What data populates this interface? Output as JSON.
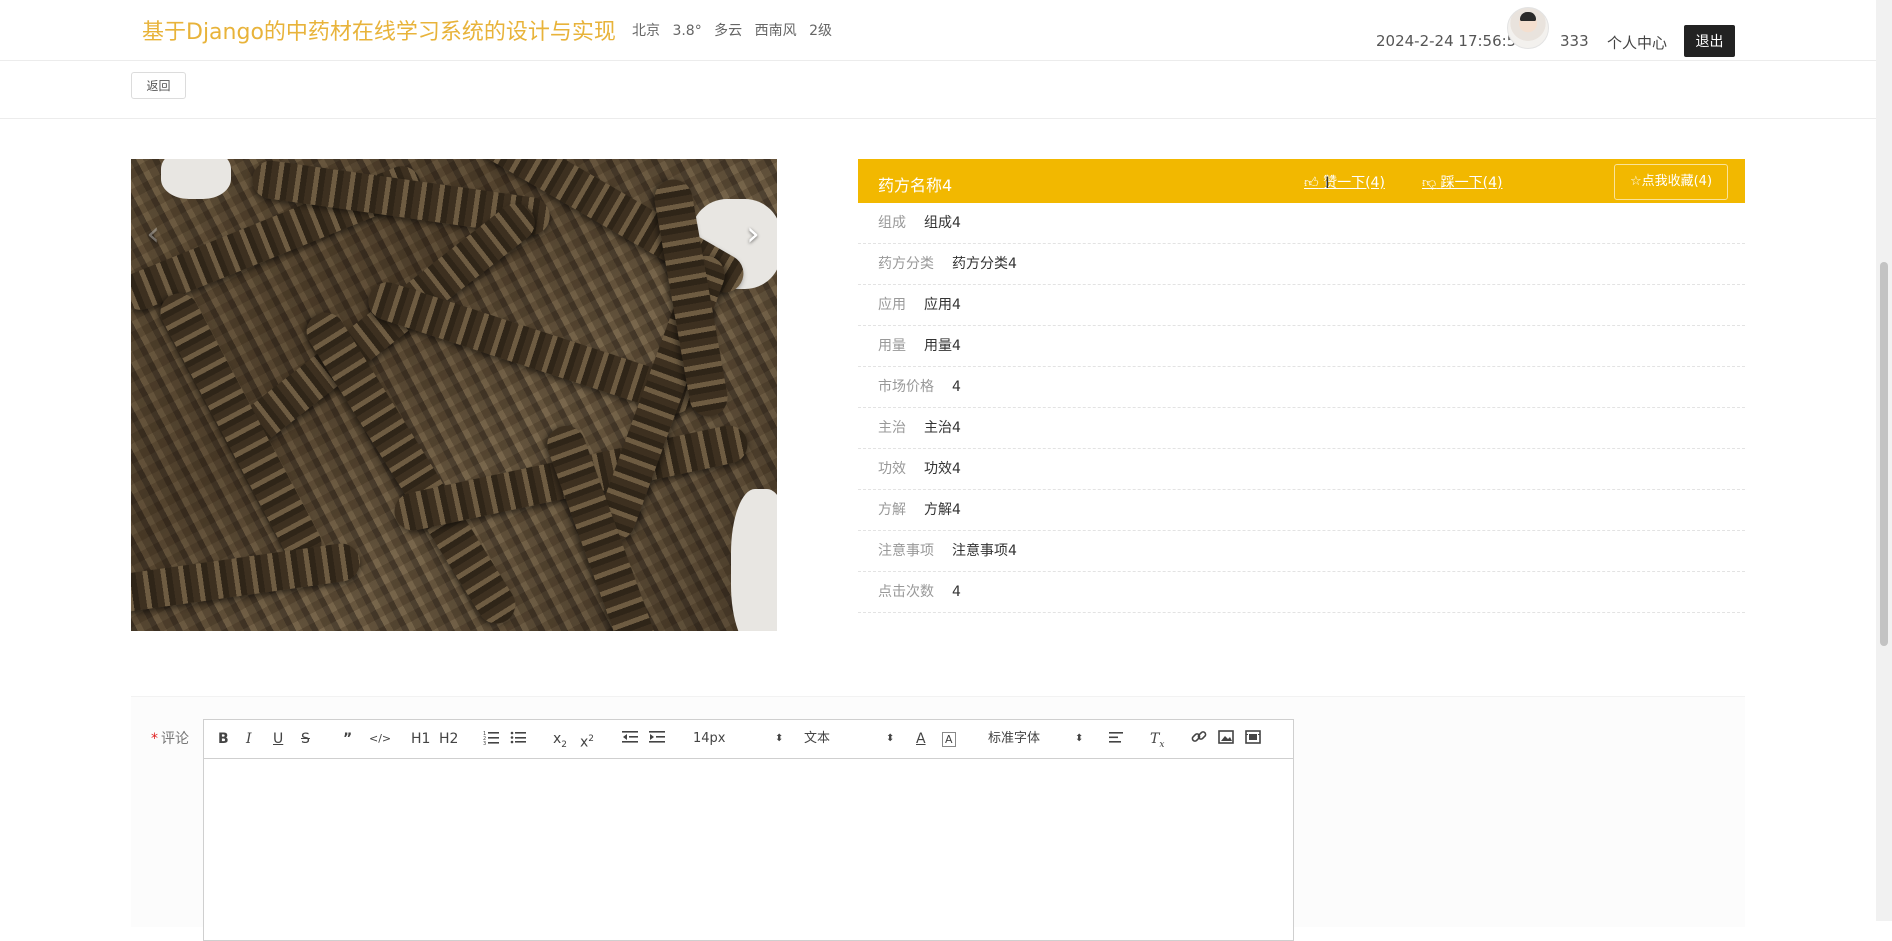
{
  "header": {
    "title": "基于Django的中药材在线学习系统的设计与实现",
    "weather": {
      "city": "北京",
      "temp": "3.8°",
      "condition": "多云",
      "wind": "西南风",
      "level": "2级"
    },
    "datetime": "2024-2-24 17:56:50",
    "username": "333",
    "user_center": "个人中心",
    "logout": "退出"
  },
  "back": "返回",
  "detail": {
    "title": "药方名称4",
    "like": "赞一下(4)",
    "dislike": "踩一下(4)",
    "collect": "点我收藏(4)",
    "rows": [
      {
        "k": "组成",
        "v": "组成4"
      },
      {
        "k": "药方分类",
        "v": "药方分类4"
      },
      {
        "k": "应用",
        "v": "应用4"
      },
      {
        "k": "用量",
        "v": "用量4"
      },
      {
        "k": "市场价格",
        "v": "4"
      },
      {
        "k": "主治",
        "v": "主治4"
      },
      {
        "k": "功效",
        "v": "功效4"
      },
      {
        "k": "方解",
        "v": "方解4"
      },
      {
        "k": "注意事项",
        "v": "注意事项4"
      },
      {
        "k": "点击次数",
        "v": "4"
      }
    ]
  },
  "comment": {
    "label": "评论",
    "required_mark": "*",
    "toolbar": {
      "size": "14px",
      "header": "文本",
      "font": "标准字体",
      "h1": "H1",
      "h2": "H2"
    }
  },
  "colors": {
    "accent": "#f2b800",
    "title": "#e8b33a",
    "logout_bg": "#222222"
  }
}
